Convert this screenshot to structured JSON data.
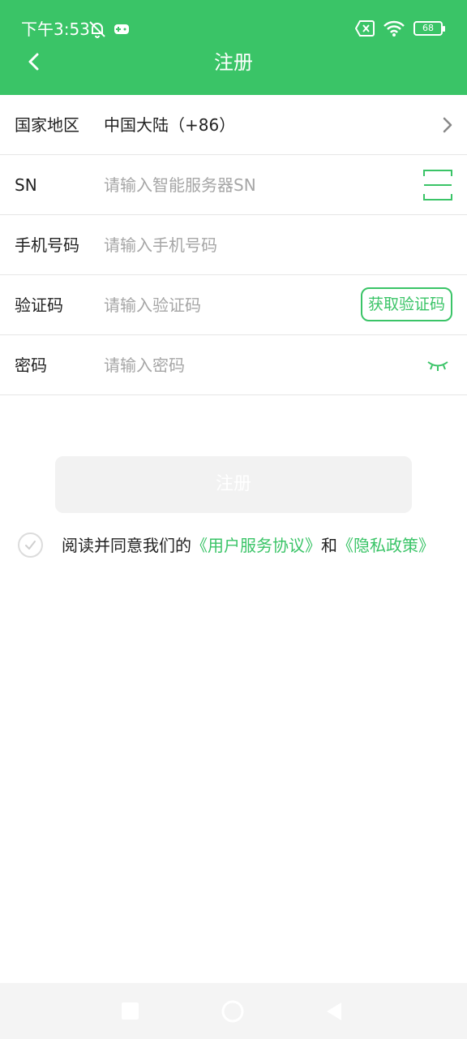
{
  "status_bar": {
    "time": "下午3:53",
    "battery": "68"
  },
  "nav": {
    "title": "注册"
  },
  "form": {
    "country": {
      "label": "国家地区",
      "value": "中国大陆（+86）"
    },
    "sn": {
      "label": "SN",
      "placeholder": "请输入智能服务器SN"
    },
    "phone": {
      "label": "手机号码",
      "placeholder": "请输入手机号码"
    },
    "code": {
      "label": "验证码",
      "placeholder": "请输入验证码",
      "button": "获取验证码"
    },
    "password": {
      "label": "密码",
      "placeholder": "请输入密码"
    }
  },
  "register_button": "注册",
  "agreement": {
    "prefix": "阅读并同意我们的",
    "user_agreement": "《用户服务协议》",
    "and": "和",
    "privacy_policy": "《隐私政策》"
  },
  "colors": {
    "accent": "#3ac467",
    "divider": "#e6e6e6",
    "placeholder": "#a6a6a6",
    "disabled_button": "#f2f2f2"
  },
  "icons": [
    "back-arrow-icon",
    "chevron-right-icon",
    "scan-icon",
    "eye-closed-icon",
    "check-circle-icon",
    "mute-bell-icon",
    "gamepad-icon",
    "sim-off-icon",
    "wifi-icon",
    "battery-icon"
  ]
}
